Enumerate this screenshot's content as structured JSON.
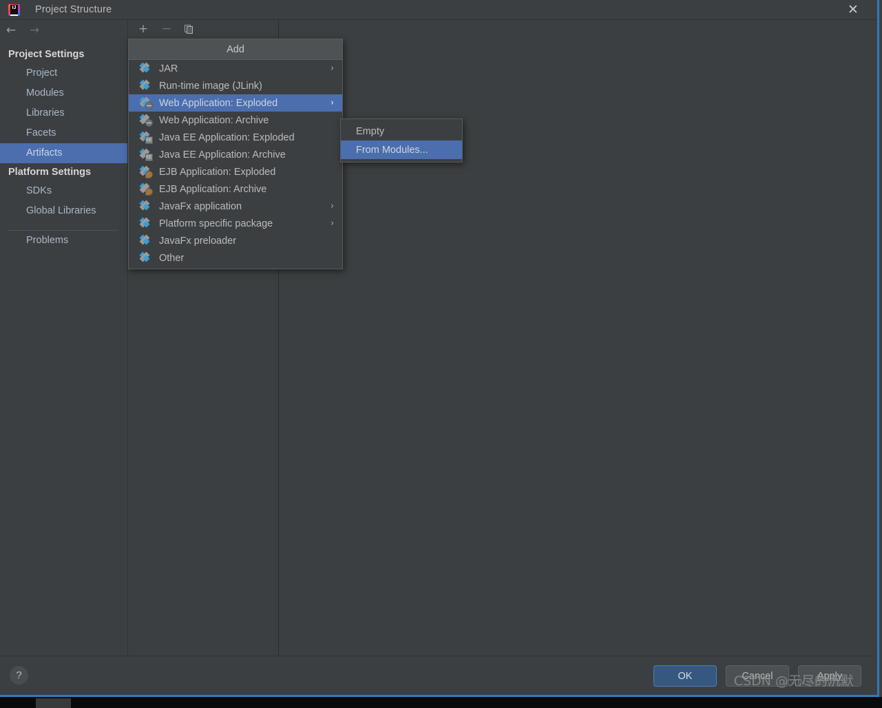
{
  "window": {
    "title": "Project Structure",
    "app_icon": "intellij-idea-logo",
    "close_icon": "✕",
    "accent_border": "#2f79c4"
  },
  "nav": {
    "back_icon": "←",
    "forward_icon": "→"
  },
  "sidebar": {
    "groups": [
      {
        "title": "Project Settings",
        "items": [
          {
            "label": "Project",
            "selected": false
          },
          {
            "label": "Modules",
            "selected": false
          },
          {
            "label": "Libraries",
            "selected": false
          },
          {
            "label": "Facets",
            "selected": false
          },
          {
            "label": "Artifacts",
            "selected": true
          }
        ]
      },
      {
        "title": "Platform Settings",
        "items": [
          {
            "label": "SDKs",
            "selected": false
          },
          {
            "label": "Global Libraries",
            "selected": false
          }
        ]
      }
    ],
    "extra_items": [
      {
        "label": "Problems",
        "selected": false
      }
    ],
    "selected_color": "#4b6eaf"
  },
  "toolbar": {
    "add_icon": "+",
    "remove_icon": "−",
    "copy_icon": "copy-icon"
  },
  "add_menu": {
    "header": "Add",
    "highlight_color": "#4b6eaf",
    "submenu_arrow": "›",
    "items": [
      {
        "label": "JAR",
        "icon": "artifact-jar-icon",
        "has_submenu": true,
        "highlight": false
      },
      {
        "label": "Run-time image (JLink)",
        "icon": "artifact-runtime-icon",
        "has_submenu": false,
        "highlight": false
      },
      {
        "label": "Web Application: Exploded",
        "icon": "artifact-web-icon",
        "has_submenu": true,
        "highlight": true
      },
      {
        "label": "Web Application: Archive",
        "icon": "artifact-web-icon",
        "has_submenu": false,
        "highlight": false
      },
      {
        "label": "Java EE Application: Exploded",
        "icon": "artifact-javaee-icon",
        "has_submenu": false,
        "highlight": false
      },
      {
        "label": "Java EE Application: Archive",
        "icon": "artifact-javaee-icon",
        "has_submenu": false,
        "highlight": false
      },
      {
        "label": "EJB Application: Exploded",
        "icon": "artifact-ejb-icon",
        "has_submenu": false,
        "highlight": false
      },
      {
        "label": "EJB Application: Archive",
        "icon": "artifact-ejb-icon",
        "has_submenu": false,
        "highlight": false
      },
      {
        "label": "JavaFx application",
        "icon": "artifact-javafx-icon",
        "has_submenu": true,
        "highlight": false
      },
      {
        "label": "Platform specific package",
        "icon": "artifact-platform-icon",
        "has_submenu": true,
        "highlight": false
      },
      {
        "label": "JavaFx preloader",
        "icon": "artifact-preloader-icon",
        "has_submenu": false,
        "highlight": false
      },
      {
        "label": "Other",
        "icon": "artifact-other-icon",
        "has_submenu": false,
        "highlight": false
      }
    ]
  },
  "sub_menu": {
    "items": [
      {
        "label": "Empty",
        "highlight": false
      },
      {
        "label": "From Modules...",
        "highlight": true
      }
    ]
  },
  "footer": {
    "help_icon": "?",
    "buttons": [
      {
        "label": "OK",
        "primary": true
      },
      {
        "label": "Cancel",
        "primary": false
      },
      {
        "label": "Apply",
        "primary": false,
        "mnemonic": "A"
      }
    ]
  },
  "watermark": {
    "text": "CSDN @无尽的沉默",
    "sub_text": "CSDN @无尽的沉默"
  }
}
